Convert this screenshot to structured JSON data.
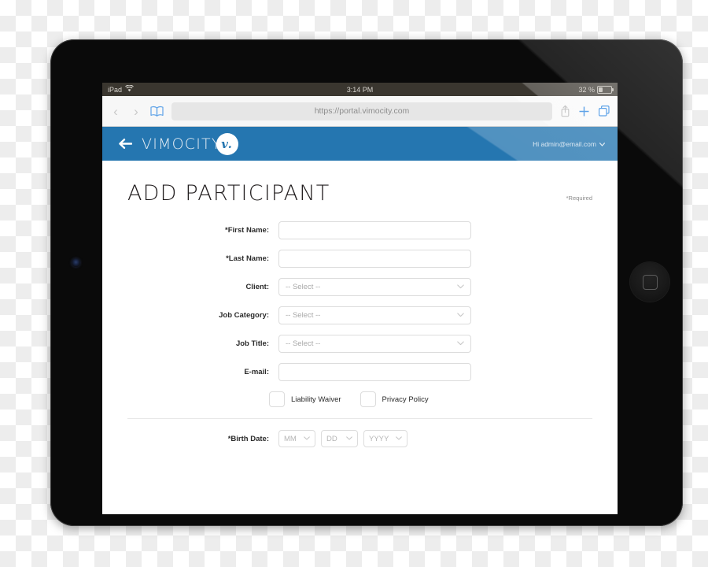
{
  "device": {
    "name": "ipad-device",
    "home_button_icon": "home-square-icon",
    "camera_icon": "front-camera-icon"
  },
  "status_bar": {
    "carrier": "iPad",
    "wifi_icon": "wifi-icon",
    "time": "3:14 PM",
    "battery_percent": "32 %",
    "battery_icon": "battery-icon",
    "battery_level": 32
  },
  "browser": {
    "back_icon": "chevron-left-icon",
    "forward_icon": "chevron-right-icon",
    "bookmarks_icon": "book-icon",
    "url": "https://portal.vimocity.com",
    "share_icon": "share-icon",
    "new_tab_icon": "plus-icon",
    "tabs_icon": "tabs-icon"
  },
  "app_header": {
    "back_icon": "arrow-left-icon",
    "brand": "VIMOCITY",
    "brand_mark": "v.",
    "user_greeting": "Hi admin@email.com",
    "user_caret_icon": "chevron-down-icon",
    "bg_color": "#2576b0",
    "bg_color_light": "#4c91c2"
  },
  "page": {
    "title": "ADD PARTICIPANT",
    "required_note": "*Required"
  },
  "form": {
    "fields": [
      {
        "label": "*First Name:",
        "type": "text",
        "value": "",
        "name": "first-name"
      },
      {
        "label": "*Last Name:",
        "type": "text",
        "value": "",
        "name": "last-name"
      },
      {
        "label": "Client:",
        "type": "select",
        "value": "-- Select --",
        "name": "client"
      },
      {
        "label": "Job Category:",
        "type": "select",
        "value": "-- Select --",
        "name": "job-category"
      },
      {
        "label": "Job Title:",
        "type": "select",
        "value": "-- Select --",
        "name": "job-title"
      },
      {
        "label": "E-mail:",
        "type": "text",
        "value": "",
        "name": "email"
      }
    ],
    "checkboxes": [
      {
        "label": "Liability Waiver",
        "checked": false,
        "name": "liability-waiver"
      },
      {
        "label": "Privacy Policy",
        "checked": false,
        "name": "privacy-policy"
      }
    ],
    "birth_date": {
      "label": "*Birth Date:",
      "month": "MM",
      "day": "DD",
      "year": "YYYY"
    }
  }
}
